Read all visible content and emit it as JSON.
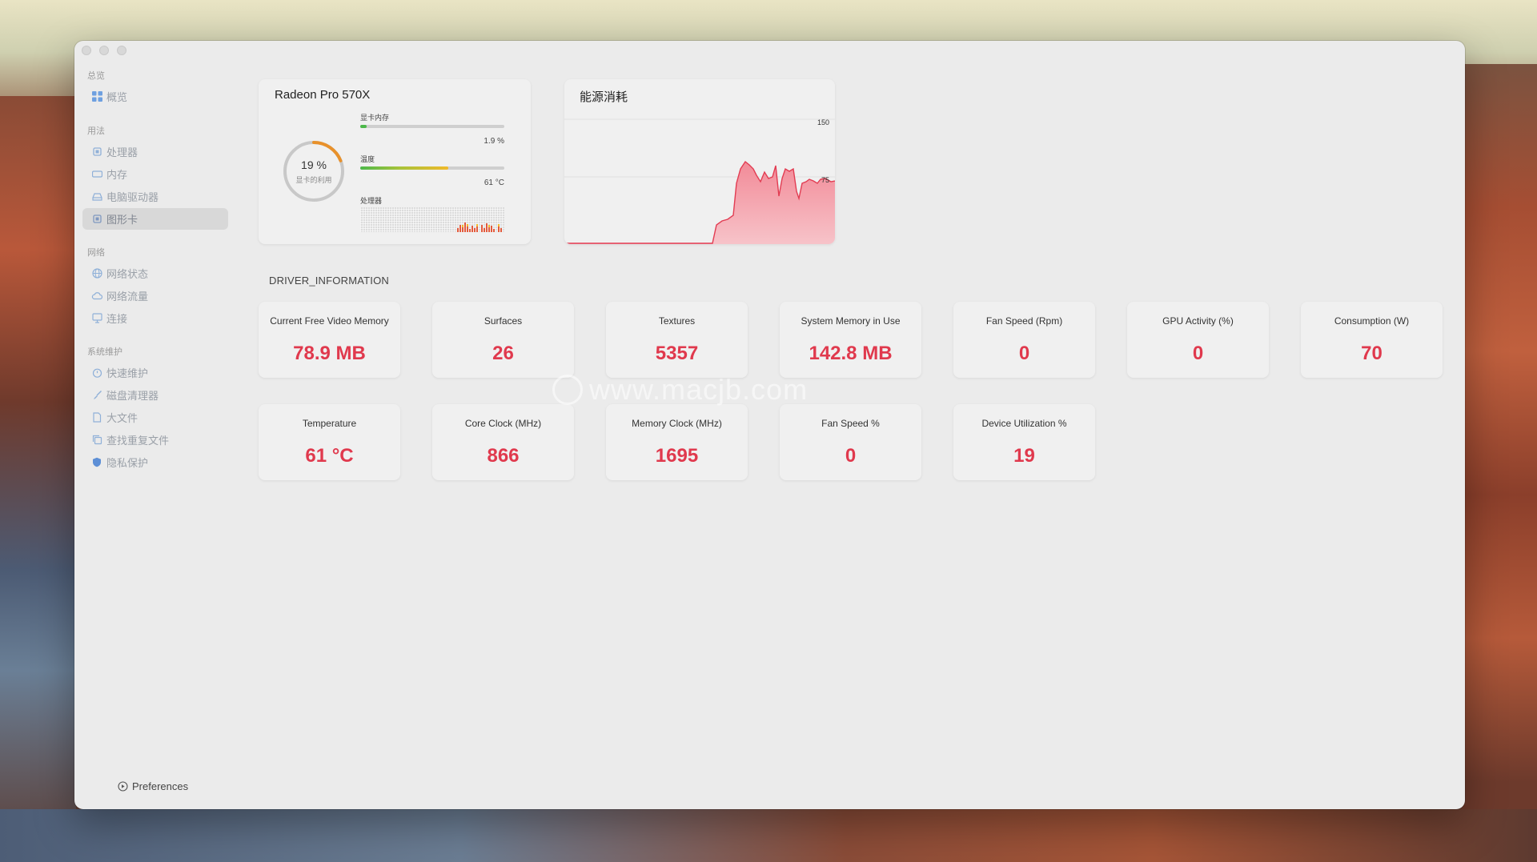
{
  "sidebar": {
    "sections": [
      {
        "title": "总览",
        "items": [
          {
            "label": "概览",
            "icon": "grid-icon"
          }
        ]
      },
      {
        "title": "用法",
        "items": [
          {
            "label": "处理器",
            "icon": "chip-icon"
          },
          {
            "label": "内存",
            "icon": "memory-icon"
          },
          {
            "label": "电脑驱动器",
            "icon": "drive-icon"
          },
          {
            "label": "图形卡",
            "icon": "gpu-icon",
            "active": true
          }
        ]
      },
      {
        "title": "网络",
        "items": [
          {
            "label": "网络状态",
            "icon": "globe-icon"
          },
          {
            "label": "网络流量",
            "icon": "cloud-icon"
          },
          {
            "label": "连接",
            "icon": "monitor-icon"
          }
        ]
      },
      {
        "title": "系统维护",
        "items": [
          {
            "label": "快速维护",
            "icon": "stopwatch-icon"
          },
          {
            "label": "磁盘清理器",
            "icon": "brush-icon"
          },
          {
            "label": "大文件",
            "icon": "file-icon"
          },
          {
            "label": "查找重复文件",
            "icon": "duplicate-icon"
          },
          {
            "label": "隐私保护",
            "icon": "shield-icon"
          }
        ]
      }
    ],
    "preferences_label": "Preferences"
  },
  "gpu": {
    "name": "Radeon Pro 570X",
    "utilization_pct": 19,
    "utilization_text": "19 %",
    "utilization_label": "显卡的利用",
    "memory_label": "显卡内存",
    "memory_value": "1.9 %",
    "memory_fraction": 0.019,
    "temp_label": "温度",
    "temp_value": "61 °C",
    "temp_fraction": 0.61,
    "processor_label": "处理器"
  },
  "energy": {
    "title": "能源消耗",
    "tick_high": "150",
    "tick_mid": "75"
  },
  "section_label": "DRIVER_INFORMATION",
  "stats_row1": [
    {
      "label": "Current Free Video Memory",
      "value": "78.9 MB"
    },
    {
      "label": "Surfaces",
      "value": "26"
    },
    {
      "label": "Textures",
      "value": "5357"
    },
    {
      "label": "System Memory in Use",
      "value": "142.8 MB"
    },
    {
      "label": "Fan Speed (Rpm)",
      "value": "0"
    },
    {
      "label": "GPU Activity (%)",
      "value": "0"
    },
    {
      "label": "Consumption (W)",
      "value": "70"
    }
  ],
  "stats_row2": [
    {
      "label": "Temperature",
      "value": "61 °C"
    },
    {
      "label": "Core Clock (MHz)",
      "value": "866"
    },
    {
      "label": "Memory Clock (MHz)",
      "value": "1695"
    },
    {
      "label": "Fan Speed %",
      "value": "0"
    },
    {
      "label": "Device Utilization %",
      "value": "19"
    }
  ],
  "watermark": "www.macjb.com",
  "colors": {
    "accent_value": "#e0394d",
    "chart_fill": "#f4a4ae",
    "chart_line": "#e23c52",
    "ring_track": "#c8c8c8",
    "ring_arc": "#e8912b"
  }
}
